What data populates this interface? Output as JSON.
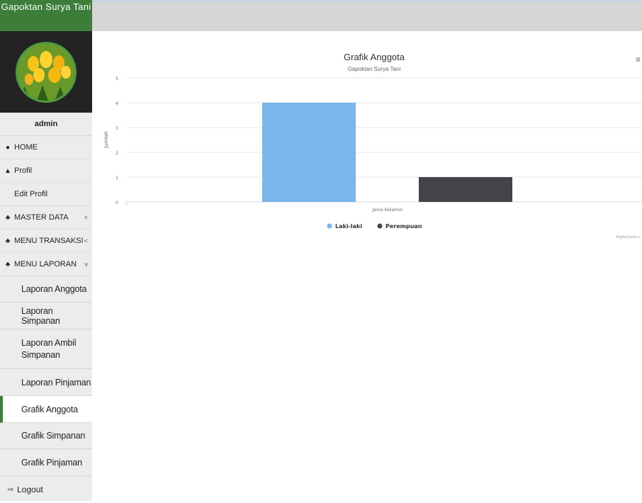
{
  "sidebar": {
    "brand": "Gapoktan Surya Tani",
    "user": "admin",
    "nav": [
      {
        "icon": "dashboard-icon",
        "glyph": "●",
        "label": "HOME",
        "chevron": ""
      },
      {
        "icon": "user-icon",
        "glyph": "▲",
        "label": "Profil",
        "chevron": ""
      }
    ],
    "sub_edit": "Edit Profil",
    "groups": [
      {
        "icon": "sitemap-icon",
        "label": "MASTER DATA",
        "chevron": "<"
      },
      {
        "icon": "sitemap-icon",
        "label": "MENU TRANSAKSI",
        "chevron": "<"
      },
      {
        "icon": "sitemap-icon",
        "label": "MENU LAPORAN",
        "chevron": "v"
      }
    ],
    "laporan": [
      "Laporan Anggota",
      "Laporan Simpanan",
      "Laporan Ambil Simpanan",
      "Laporan Pinjaman",
      "Grafik Anggota",
      "Grafik Simpanan",
      "Grafik Pinjaman"
    ],
    "active_item": "Grafik Anggota",
    "logout": "Logout"
  },
  "chart_data": {
    "type": "bar",
    "title": "Grafik Anggota",
    "subtitle": "Gapoktan Surya Tani",
    "xlabel": "Jenis Kelamin",
    "ylabel": "Jumlah",
    "ylim": [
      0,
      5
    ],
    "yticks": [
      "0",
      "1",
      "2",
      "3",
      "4",
      "5"
    ],
    "series": [
      {
        "name": "Laki-laki",
        "values": [
          4
        ],
        "color": "#7cb5ec"
      },
      {
        "name": "Perempuan",
        "values": [
          1
        ],
        "color": "#434348"
      }
    ],
    "credits": "Highcharts.c",
    "grid": true,
    "legend_position": "bottom-center"
  }
}
